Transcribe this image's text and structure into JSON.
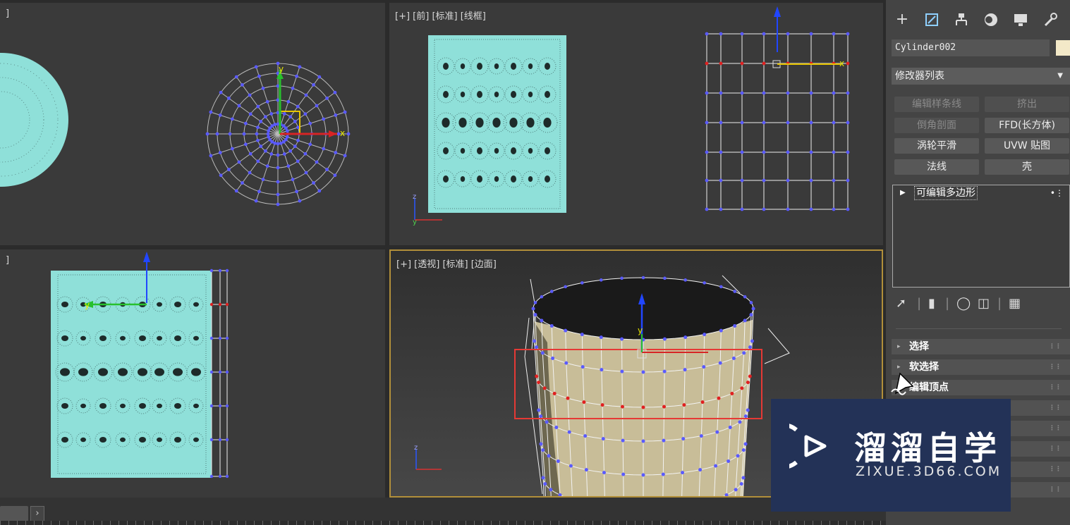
{
  "viewports": {
    "top_left": {
      "label": "]"
    },
    "front": {
      "label": "[+] [前] [标准] [线框]"
    },
    "left": {
      "label": "]"
    },
    "perspective": {
      "label": "[+] [透视] [标准] [边面]"
    }
  },
  "panel": {
    "object_name": "Cylinder002",
    "object_color": "#f3e9c8",
    "modifier_list_label": "修改器列表",
    "modifier_buttons": [
      {
        "label": "编辑样条线",
        "enabled": false
      },
      {
        "label": "挤出",
        "enabled": false
      },
      {
        "label": "倒角剖面",
        "enabled": false
      },
      {
        "label": "FFD(长方体)",
        "enabled": true
      },
      {
        "label": "涡轮平滑",
        "enabled": true
      },
      {
        "label": "UVW 贴图",
        "enabled": true
      },
      {
        "label": "法线",
        "enabled": true
      },
      {
        "label": "壳",
        "enabled": true
      }
    ],
    "stack": [
      {
        "label": "可编辑多边形"
      }
    ],
    "rollouts": [
      {
        "label": "选择"
      },
      {
        "label": "软选择"
      },
      {
        "label": "编辑顶点"
      }
    ]
  },
  "watermark": {
    "title": "溜溜自学",
    "subtitle": "ZIXUE.3D66.COM"
  },
  "icons": [
    "create-icon",
    "modify-icon",
    "hierarchy-icon",
    "motion-icon",
    "display-icon",
    "utilities-icon",
    "pin-stack-icon",
    "show-end-result-icon",
    "make-unique-icon",
    "remove-modifier-icon",
    "configure-sets-icon",
    "chevron-right-icon",
    "cursor-icon"
  ],
  "colors": {
    "accent_border": "#b18f3a",
    "mesh_cyan": "#8fe0d9",
    "vertex_blue": "#5a5aff",
    "vertex_red": "#e02020",
    "selection_rect": "#e53935"
  }
}
